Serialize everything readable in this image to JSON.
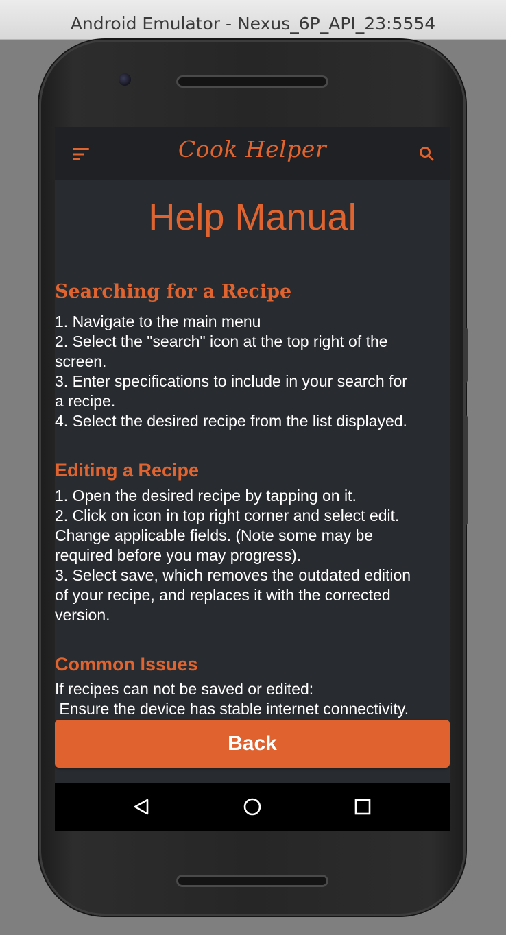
{
  "window": {
    "title": "Android Emulator - Nexus_6P_API_23:5554"
  },
  "appbar": {
    "title": "Cook Helper",
    "menu_icon": "hamburger-menu-icon",
    "search_icon": "search-icon"
  },
  "page": {
    "title": "Help Manual"
  },
  "sections": [
    {
      "heading": "Searching for a Recipe",
      "lines": [
        "1. Navigate to the main menu",
        "2. Select the \"search\" icon at the top right of the",
        "screen.",
        "3. Enter specifications to include in your search for",
        "a recipe.",
        "4. Select the desired recipe from the list displayed."
      ]
    },
    {
      "heading": "Editing a Recipe",
      "lines": [
        "1. Open the desired recipe by tapping on it.",
        "2. Click on icon in top right corner and select edit.",
        "Change applicable fields. (Note some may be",
        "required before you may progress).",
        "3. Select save, which removes the outdated edition",
        "of your recipe, and replaces it with the corrected",
        "version."
      ]
    },
    {
      "heading": "Common Issues",
      "lines": [
        "If recipes can not be saved or edited:",
        " Ensure the device has stable internet connectivity."
      ]
    }
  ],
  "back_button": {
    "label": "Back"
  },
  "navbar": {
    "back_icon": "triangle-back-icon",
    "home_icon": "circle-home-icon",
    "recents_icon": "square-recents-icon"
  },
  "colors": {
    "accent": "#e0642f",
    "screen_bg": "#282b2f",
    "appbar_bg": "#1f2124",
    "text": "#ffffff"
  }
}
